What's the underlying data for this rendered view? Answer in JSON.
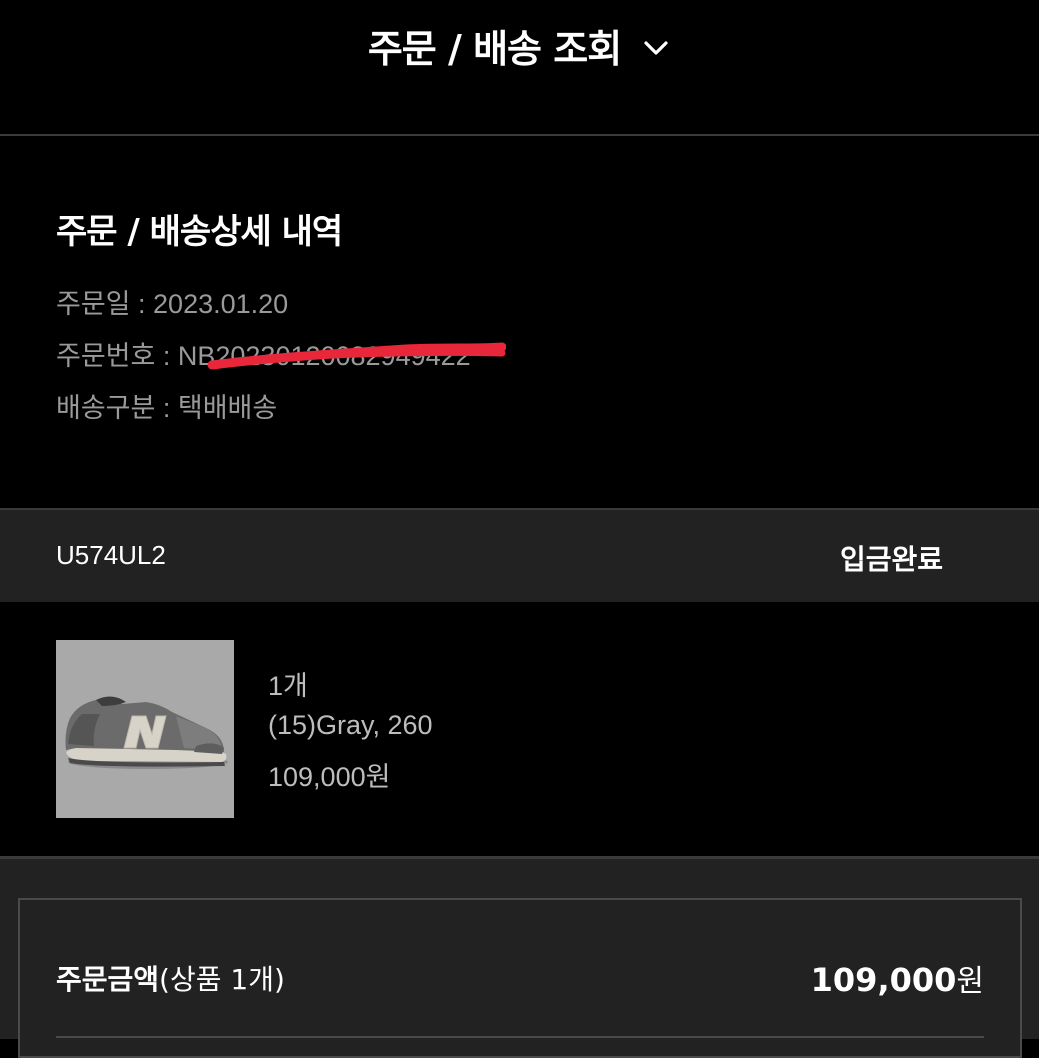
{
  "header": {
    "title": "주문 / 배송 조회",
    "toggle_icon": "chevron-down-icon"
  },
  "detail": {
    "title": "주문 / 배송상세 내역",
    "order_date_label": "주문일 : ",
    "order_date": "2023.01.20",
    "order_no_label": "주문번호 : ",
    "order_no": "NB20230120082949422",
    "ship_type_label": "배송구분 : ",
    "ship_type": "택배배송"
  },
  "status": {
    "product_code": "U574UL2",
    "text": "입금완료"
  },
  "product": {
    "image_icon": "sneaker-image",
    "quantity": "1개",
    "color_size": "(15)Gray, 260",
    "price": "109,000원"
  },
  "summary": {
    "label": "주문금액",
    "label_sub": "(상품 1개)",
    "amount": "109,000",
    "unit": "원"
  },
  "colors": {
    "background": "#000000",
    "panel": "#222222",
    "redact": "#e8283a"
  }
}
